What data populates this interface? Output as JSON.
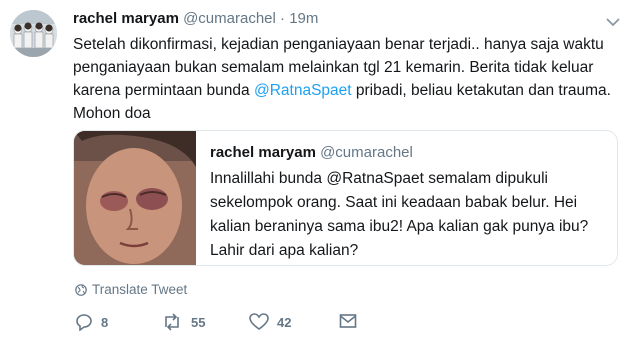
{
  "tweet": {
    "author_name": "rachel maryam",
    "author_handle": "@cumarachel",
    "separator": "·",
    "time": "19m",
    "text_before_mention": "Setelah dikonfirmasi, kejadian penganiayaan benar terjadi.. hanya saja waktu penganiayaan bukan semalam melainkan tgl 21 kemarin. Berita tidak keluar karena permintaan bunda ",
    "mention": "@RatnaSpaet",
    "text_after_mention": " pribadi, beliau ketakutan dan trauma. Mohon doa"
  },
  "quoted_tweet": {
    "author_name": "rachel maryam",
    "author_handle": "@cumarachel",
    "text": "Innalillahi bunda @RatnaSpaet semalam dipukuli sekelompok orang. Saat ini keadaan babak belur. Hei kalian beraninya sama ibu2! Apa kalian gak punya ibu? Lahir dari apa kalian?"
  },
  "translate_label": "Translate Tweet",
  "actions": {
    "reply_count": "8",
    "retweet_count": "55",
    "like_count": "42"
  },
  "icons": {
    "menu": "chevron-down-icon",
    "translate": "globe-icon",
    "reply": "reply-icon",
    "retweet": "retweet-icon",
    "like": "heart-icon",
    "dm": "envelope-icon"
  },
  "colors": {
    "link": "#1da1f2",
    "secondary_text": "#657786",
    "primary_text": "#14171a",
    "border": "#e1e8ed"
  }
}
